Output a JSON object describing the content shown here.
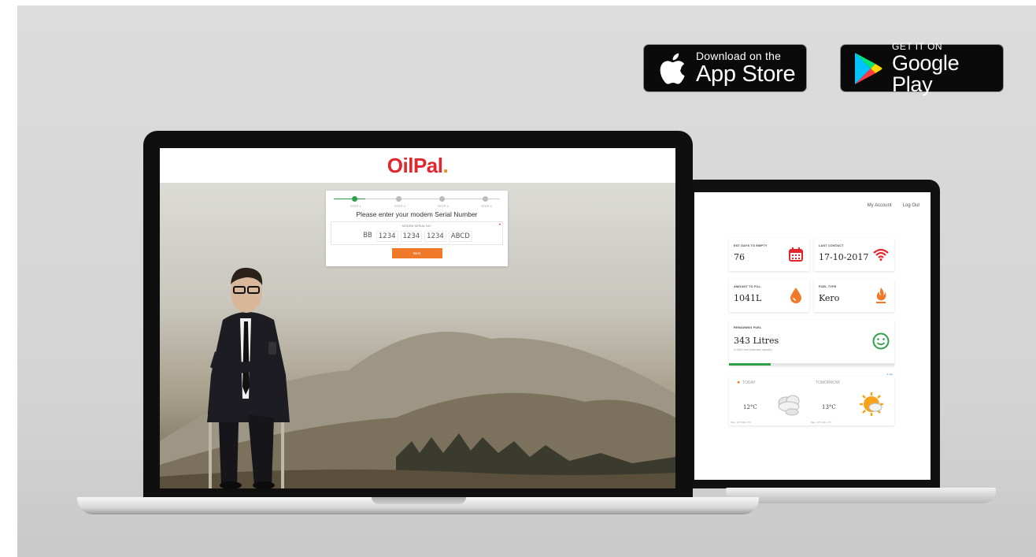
{
  "badges": {
    "apple": {
      "line1": "Download on the",
      "line2": "App Store"
    },
    "google": {
      "line1": "GET IT ON",
      "line2": "Google Play"
    }
  },
  "front": {
    "logo_main": "OilPal",
    "logo_dot": ".",
    "steps": [
      "STEP 1",
      "STEP 2",
      "STEP 3",
      "STEP 4"
    ],
    "serial_title": "Please enter your modem Serial Number",
    "serial_caption": "MODEM SERIAL NO.",
    "serial_fields": [
      "BB",
      "1234",
      "1234",
      "1234",
      "ABCD"
    ],
    "next_label": "Next"
  },
  "back": {
    "nav": [
      "My Account",
      "Log Out"
    ],
    "cards": {
      "est_days": {
        "label": "EST DAYS TO EMPTY",
        "value": "76"
      },
      "last_contact": {
        "label": "LAST CONTACT",
        "value": "17-10-2017"
      },
      "amount_fill": {
        "label": "AMOUNT TO FILL",
        "value": "1041L"
      },
      "fuel_type": {
        "label": "FUEL TYPE",
        "value": "Kero"
      },
      "remaining": {
        "label": "REMAINING FUEL",
        "value": "343 Litres",
        "sub": "of 1384 Litres (estimated capacity)",
        "fraction": 0.25
      }
    },
    "weather": {
      "link": "5 day",
      "today": "TODAY",
      "tomorrow": "TOMORROW",
      "today_temp": "12°C",
      "tomorrow_temp": "13°C",
      "today_sub": "Max: 13°C Min: 9°C",
      "tomorrow_sub": "Max: 13°C Min: 4°C"
    }
  },
  "colors": {
    "brand_red": "#e1262d",
    "brand_orange": "#f07a2a",
    "green": "#2ea04a"
  }
}
